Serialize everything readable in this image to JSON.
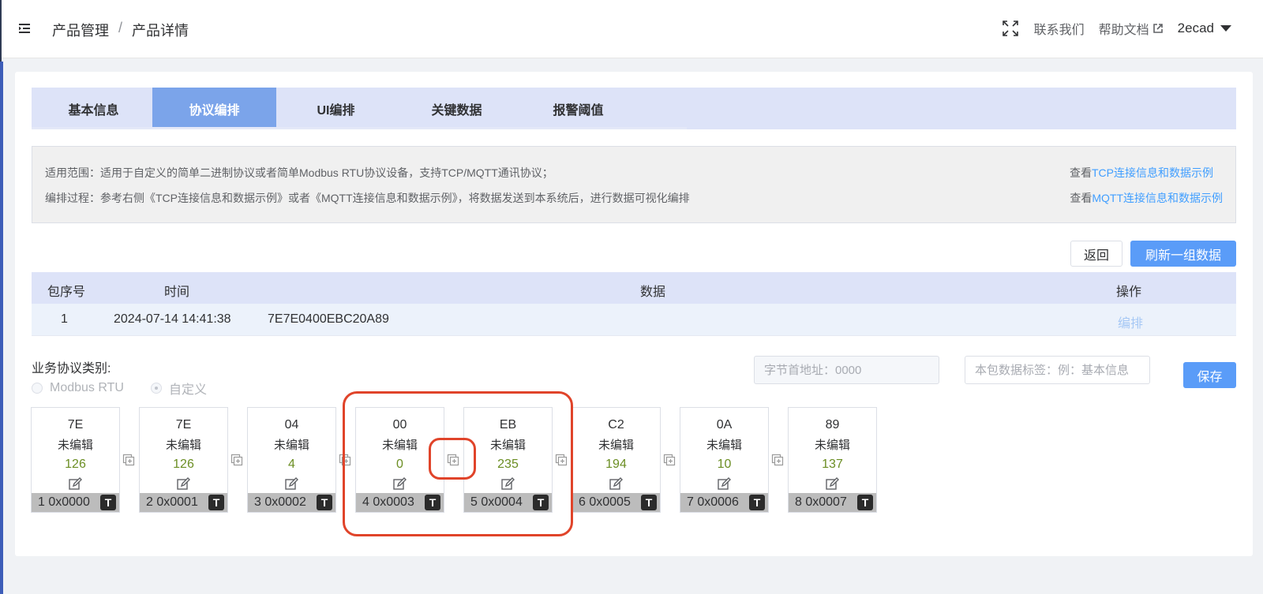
{
  "header": {
    "breadcrumb": [
      "产品管理",
      "/",
      "产品详情"
    ],
    "contact": "联系我们",
    "help": "帮助文档",
    "user": "2ecad"
  },
  "tabs": [
    "基本信息",
    "协议编排",
    "UI编排",
    "关键数据",
    "报警阈值"
  ],
  "active_tab": "协议编排",
  "info": {
    "line1": "适用范围：适用于自定义的简单二进制协议或者简单Modbus RTU协议设备，支持TCP/MQTT通讯协议；",
    "line2": "编排过程：参考右侧《TCP连接信息和数据示例》或者《MQTT连接信息和数据示例》，将数据发送到本系统后，进行数据可视化编排",
    "view_prefix": "查看",
    "tcp_link": "TCP连接信息和数据示例",
    "mqtt_link": "MQTT连接信息和数据示例"
  },
  "buttons": {
    "back": "返回",
    "refresh": "刷新一组数据",
    "save": "保存"
  },
  "table": {
    "headers": [
      "包序号",
      "时间",
      "数据",
      "操作"
    ],
    "rows": [
      {
        "seq": "1",
        "time": "2024-07-14 14:41:38",
        "data": "7E7E0400EBC20A89",
        "action": "编排"
      }
    ]
  },
  "protocol": {
    "label": "业务协议类别:",
    "options": [
      "Modbus RTU",
      "自定义"
    ],
    "selected": "自定义"
  },
  "inputs": {
    "addr_placeholder": "字节首地址：0000",
    "tag_placeholder": "本包数据标签：例：基本信息"
  },
  "bytes": [
    {
      "hex": "7E",
      "status": "未编辑",
      "dec": "126",
      "addr": "1 0x0000"
    },
    {
      "hex": "7E",
      "status": "未编辑",
      "dec": "126",
      "addr": "2 0x0001"
    },
    {
      "hex": "04",
      "status": "未编辑",
      "dec": "4",
      "addr": "3 0x0002"
    },
    {
      "hex": "00",
      "status": "未编辑",
      "dec": "0",
      "addr": "4 0x0003"
    },
    {
      "hex": "EB",
      "status": "未编辑",
      "dec": "235",
      "addr": "5 0x0004"
    },
    {
      "hex": "C2",
      "status": "未编辑",
      "dec": "194",
      "addr": "6 0x0005"
    },
    {
      "hex": "0A",
      "status": "未编辑",
      "dec": "10",
      "addr": "7 0x0006"
    },
    {
      "hex": "89",
      "status": "未编辑",
      "dec": "137",
      "addr": "8 0x0007"
    }
  ],
  "type_button": "T",
  "colors": {
    "accent": "#5a9cf8",
    "tab_active": "#7ba4ea",
    "highlight": "#e0442a",
    "decimal": "#6b8e23"
  }
}
